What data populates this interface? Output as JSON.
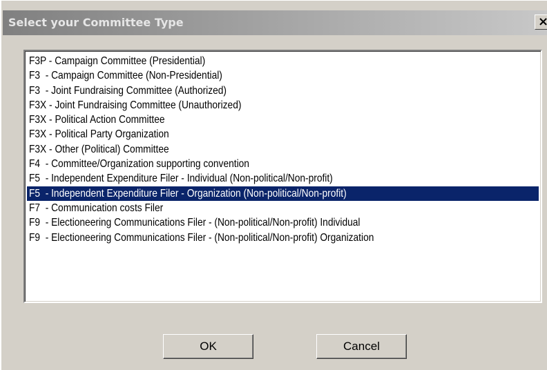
{
  "window": {
    "title": "Select your Committee Type",
    "close_glyph": "×"
  },
  "list": {
    "selected_index": 9,
    "items": [
      "F3P - Campaign Committee (Presidential)",
      "F3  - Campaign Committee (Non-Presidential)",
      "F3  - Joint Fundraising Committee (Authorized)",
      "F3X - Joint Fundraising Committee (Unauthorized)",
      "F3X - Political Action Committee",
      "F3X - Political Party Organization",
      "F3X - Other (Political) Committee",
      "F4  - Committee/Organization supporting convention",
      "F5  - Independent Expenditure Filer - Individual (Non-political/Non-profit)",
      "F5  - Independent Expenditure Filer - Organization (Non-political/Non-profit)",
      "F7  - Communication costs Filer",
      "F9  - Electioneering Communications Filer - (Non-political/Non-profit) Individual",
      "F9  - Electioneering Communications Filer - (Non-political/Non-profit) Organization"
    ]
  },
  "buttons": {
    "ok_label": "OK",
    "cancel_label": "Cancel"
  },
  "colors": {
    "selection": "#0a246a",
    "dialog_face": "#d4d0c8"
  }
}
